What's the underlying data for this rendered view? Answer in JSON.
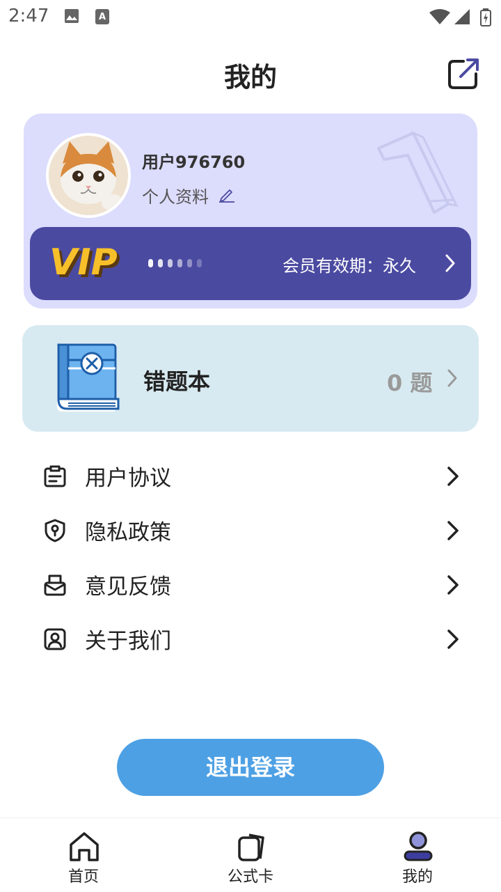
{
  "status_bar": {
    "time": "2:47"
  },
  "header": {
    "title": "我的"
  },
  "profile": {
    "username": "用户976760",
    "profile_link": "个人资料"
  },
  "vip": {
    "logo_text": "VIP",
    "validity": "会员有效期：永久"
  },
  "wrong_book": {
    "title": "错题本",
    "count": "0 题"
  },
  "menu": {
    "items": [
      {
        "label": "用户协议",
        "icon": "document-icon"
      },
      {
        "label": "隐私政策",
        "icon": "shield-lock-icon"
      },
      {
        "label": "意见反馈",
        "icon": "feedback-mail-icon"
      },
      {
        "label": "关于我们",
        "icon": "person-card-icon"
      }
    ]
  },
  "logout": {
    "label": "退出登录"
  },
  "bottom_nav": {
    "items": [
      {
        "label": "首页",
        "icon": "home-icon",
        "active": false
      },
      {
        "label": "公式卡",
        "icon": "cards-icon",
        "active": false
      },
      {
        "label": "我的",
        "icon": "profile-icon",
        "active": true
      }
    ]
  },
  "colors": {
    "profile_card_bg": "#dcdcfd",
    "vip_bar_bg": "#4b4aa1",
    "wrong_card_bg": "#d8eaf1",
    "logout_button": "#4ea0e4",
    "active_nav": "#8f93d9"
  }
}
